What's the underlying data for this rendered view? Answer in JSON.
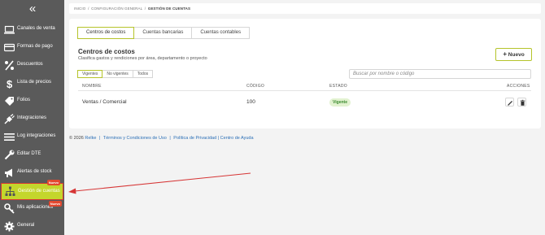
{
  "sidebar": {
    "items": [
      {
        "label": "Canales de venta",
        "icon": "laptop-icon"
      },
      {
        "label": "Formas de pago",
        "icon": "credit-card-icon"
      },
      {
        "label": "Descuentos",
        "icon": "percent-icon"
      },
      {
        "label": "Lista de precios",
        "icon": "dollar-icon"
      },
      {
        "label": "Folios",
        "icon": "tag-icon"
      },
      {
        "label": "Integraciones",
        "icon": "plug-icon"
      },
      {
        "label": "Log integraciones",
        "icon": "list-icon"
      },
      {
        "label": "Editar DTE",
        "icon": "wrench-icon"
      },
      {
        "label": "Alertas de stock",
        "icon": "megaphone-icon"
      },
      {
        "label": "Gestión de cuentas",
        "icon": "sitemap-icon",
        "badge": "Nuevo"
      },
      {
        "label": "Mis aplicaciones",
        "icon": "key-icon",
        "badge": "Nuevo"
      },
      {
        "label": "General",
        "icon": "gear-icon"
      }
    ]
  },
  "breadcrumb": {
    "home": "INICIO",
    "sep": "/",
    "level1": "CONFIGURACIÓN GENERAL",
    "current": "GESTIÓN DE CUENTAS"
  },
  "tabs": [
    "Centros de costos",
    "Cuentas bancarias",
    "Cuentas contables"
  ],
  "section": {
    "title": "Centros de costos",
    "subtitle": "Clasifica gastos y rendiciones por área, departamento o proyecto",
    "new_button": "Nuevo"
  },
  "filters": [
    "Vigentes",
    "No vigentes",
    "Todos"
  ],
  "search": {
    "placeholder": "Buscar por nombre o código"
  },
  "table": {
    "headers": {
      "name": "NOMBRE",
      "code": "CÓDIGO",
      "status": "ESTADO",
      "actions": "ACCIONES"
    },
    "rows": [
      {
        "name": "Ventas / Comercial",
        "code": "100",
        "status": "Vigente"
      }
    ]
  },
  "footer": {
    "copyright": "© 2026",
    "brand": "Relke",
    "terms": "Términos y Condiciones de Uso",
    "privacy": "Política de Privacidad",
    "help": "Centro de Ayuda"
  },
  "colors": {
    "sidebar_bg": "#5a5a5a",
    "accent": "#c4d62c",
    "badge": "#e2482f",
    "highlight_box": "#d63535",
    "status_bg": "#e2f2d0",
    "status_text": "#3b8b2f",
    "link": "#2b6fb6"
  }
}
